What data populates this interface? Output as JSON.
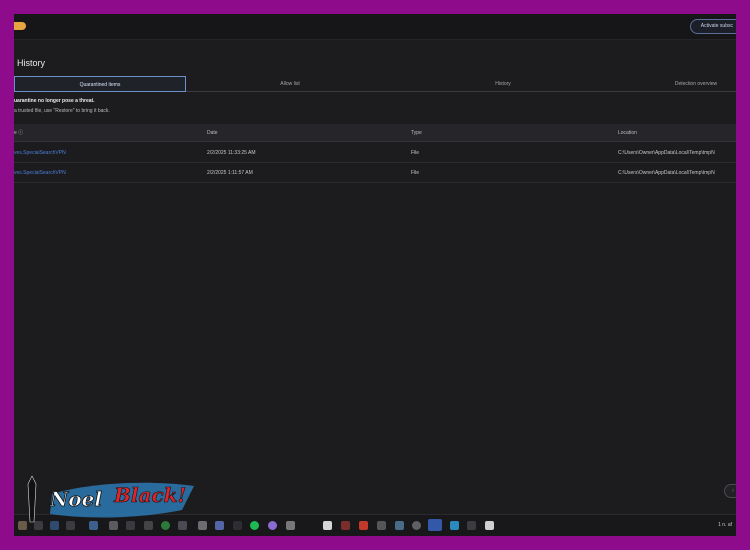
{
  "app": {
    "page_title": "History",
    "activate_button": "Activate subsc"
  },
  "tabs": [
    {
      "label": "Quarantined items",
      "active": true
    },
    {
      "label": "Allow list",
      "active": false
    },
    {
      "label": "History",
      "active": false
    },
    {
      "label": "Detection overview",
      "active": false
    }
  ],
  "notice": {
    "heading": "uarantine no longer pose a threat.",
    "body": "a trusted file, use \"Restore\" to bring it back."
  },
  "table": {
    "columns": [
      "e ⓘ",
      "Date",
      "Type",
      "Location"
    ],
    "rows": [
      {
        "name": "ves.SpecialSearchVPN",
        "date": "2/2/2025 11:33:25 AM",
        "type": "File",
        "location": "C:\\Users\\Owner\\AppData\\Local\\Temp\\tmpN"
      },
      {
        "name": "ves.SpecialSearchVPN",
        "date": "2/2/2025 1:11:57 AM",
        "type": "File",
        "location": "C:\\Users\\Owner\\AppData\\Local\\Temp\\tmpN"
      }
    ]
  },
  "scroll_pill": "↑",
  "taskbar": {
    "tray_text": "1 n. af"
  },
  "watermark": {
    "line1": "Noel",
    "line2": "Black!"
  },
  "colors": {
    "frame": "#8e0b8c",
    "background": "#1c1c1e",
    "accent": "#4d7fd9",
    "badge": "#e7a542"
  }
}
